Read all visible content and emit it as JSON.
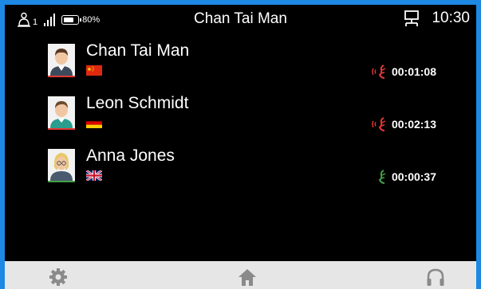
{
  "status_bar": {
    "people_count": "1",
    "battery_percent": "80%",
    "battery_level": 0.8,
    "title": "Chan Tai Man",
    "time": "10:30",
    "icons": [
      "person-icon",
      "signal-icon",
      "battery-icon",
      "network-icon"
    ]
  },
  "participants": [
    {
      "name": "Chan Tai Man",
      "flag": "china-flag-icon",
      "duration": "00:01:08",
      "status": "speaking",
      "status_color": "#e53935",
      "avatar": "male-avatar-icon",
      "avatar_line_color": "#e53935"
    },
    {
      "name": "Leon Schmidt",
      "flag": "germany-flag-icon",
      "duration": "00:02:13",
      "status": "speaking",
      "status_color": "#e53935",
      "avatar": "male-avatar-icon",
      "avatar_line_color": "#e53935"
    },
    {
      "name": "Anna Jones",
      "flag": "uk-flag-icon",
      "duration": "00:00:37",
      "status": "listening",
      "status_color": "#43a047",
      "avatar": "female-avatar-icon",
      "avatar_line_color": "#43a047"
    }
  ],
  "nav": {
    "items": [
      "settings-icon",
      "home-icon",
      "headphones-icon"
    ]
  },
  "colors": {
    "background": "#000000",
    "frame": "#1e88e5",
    "navbar": "#e6e6e6",
    "nav_icon": "#8a8a8a"
  }
}
